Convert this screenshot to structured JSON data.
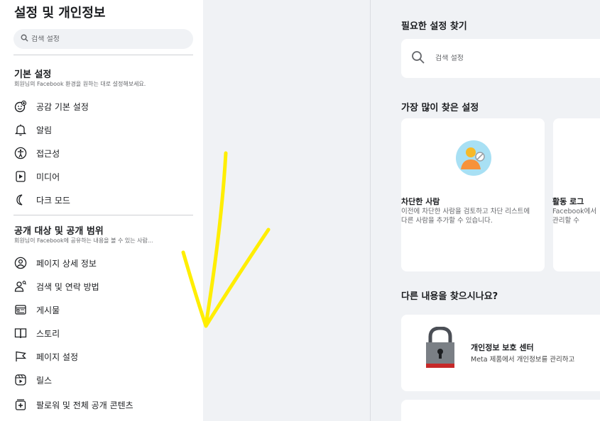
{
  "sidebar": {
    "title": "설정 및 개인정보",
    "search_placeholder": "검색 설정",
    "sections": [
      {
        "heading": "기본 설정",
        "subtitle": "회원님의 Facebook 환경을 원하는 대로 설정해보세요.",
        "items": [
          {
            "label": "공감 기본 설정",
            "icon": "reaction-icon"
          },
          {
            "label": "알림",
            "icon": "bell-icon"
          },
          {
            "label": "접근성",
            "icon": "accessibility-icon"
          },
          {
            "label": "미디어",
            "icon": "media-icon"
          },
          {
            "label": "다크 모드",
            "icon": "moon-icon"
          }
        ]
      },
      {
        "heading": "공개 대상 및 공개 범위",
        "subtitle": "회원님이 Facebook에 공유하는 내용을 볼 수 있는 사람...",
        "items": [
          {
            "label": "페이지 상세 정보",
            "icon": "profile-circle-icon"
          },
          {
            "label": "검색 및 연락 방법",
            "icon": "person-search-icon"
          },
          {
            "label": "게시물",
            "icon": "posts-icon"
          },
          {
            "label": "스토리",
            "icon": "book-icon"
          },
          {
            "label": "페이지 설정",
            "icon": "flag-icon"
          },
          {
            "label": "릴스",
            "icon": "reels-icon"
          },
          {
            "label": "팔로워 및 전체 공개 콘텐츠",
            "icon": "followers-icon"
          }
        ]
      }
    ]
  },
  "main": {
    "find_heading": "필요한 설정 찾기",
    "search_placeholder": "검색 설정",
    "popular_heading": "가장 많이 찾은 설정",
    "cards": [
      {
        "title": "차단한 사람",
        "desc": "이전에 차단한 사람을 검토하고 차단 리스트에 다른 사람을 추가할 수 있습니다.",
        "icon": "blocked-person-icon"
      },
      {
        "title": "활동 로그",
        "desc": "Facebook에서 관리할 수",
        "icon": "activity-log-icon"
      }
    ],
    "other_heading": "다른 내용을 찾으시나요?",
    "privacy_center": {
      "title": "개인정보 보호 센터",
      "desc": "Meta 제품에서 개인정보를 관리하고"
    }
  },
  "colors": {
    "annotation": "#ffee00",
    "background": "#f0f2f5",
    "card": "#ffffff"
  }
}
